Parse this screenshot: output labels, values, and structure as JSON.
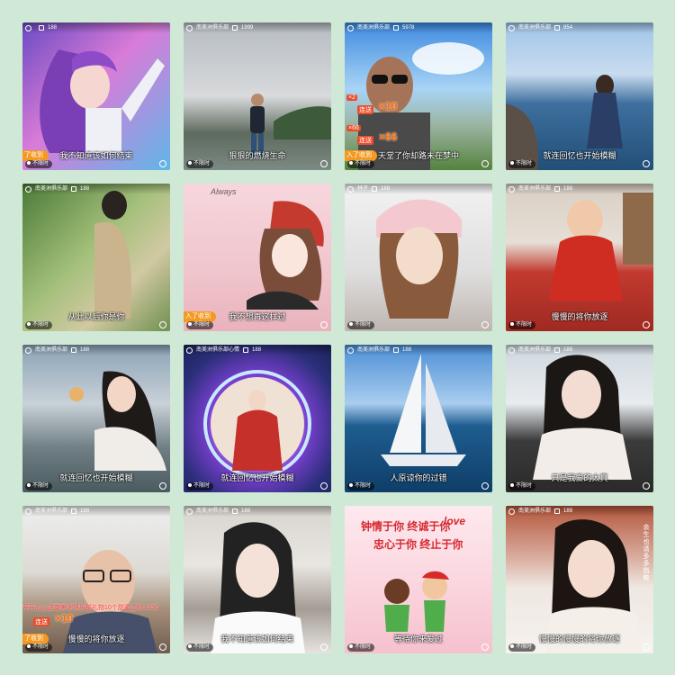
{
  "tiles": [
    {
      "header_name": "",
      "header_count": "188",
      "ticker": "了收到",
      "caption": "我不知道该如何结束",
      "tag": "不限时",
      "bg": "linear-gradient(135deg,#6b4bc2 0%,#d97bd8 45%,#5fb7e8 100%)"
    },
    {
      "header_name": "南美洲俱乐部",
      "header_count": "1999",
      "ticker": "",
      "caption": "狠狠的燃烧生命",
      "tag": "不限时",
      "bg": "linear-gradient(180deg,#b6bcc2 0%,#d8dadc 50%,#5d6a5e 75%,#7b8a84 100%)"
    },
    {
      "header_name": "南美洲俱乐部",
      "header_count": "5978",
      "ticker": "入了收到",
      "caption": "天堂了你却路未在梦中",
      "tag": "不限时",
      "bg": "linear-gradient(180deg,#3f8ae0 0%,#a8d4f5 45%,#9ab4a0 70%,#56823f 100%)",
      "combos": [
        {
          "label": "连送",
          "value": "×10"
        },
        {
          "label": "连送",
          "value": "×66"
        }
      ],
      "gift_counts": [
        "×2",
        "×66"
      ]
    },
    {
      "header_name": "南美洲俱乐部",
      "header_count": "954",
      "ticker": "",
      "caption": "就连回忆也开始模糊",
      "tag": "不限时",
      "bg": "linear-gradient(180deg,#9fc4e8 0%,#c9dcef 35%,#3e6f9e 55%,#224f78 100%)"
    },
    {
      "header_name": "南美洲俱乐部",
      "header_count": "188",
      "ticker": "",
      "caption": "从此以后你是你",
      "tag": "不限时",
      "bg": "linear-gradient(135deg,#4b7a38 0%,#a3c07a 45%,#d1c9a2 70%,#6f8f4f 100%)"
    },
    {
      "header_name": "",
      "header_count": "",
      "ticker": "入了收到",
      "caption": "我不想再这样过",
      "tag": "不限时",
      "bg": "linear-gradient(180deg,#f6d7dd 0%,#f0c5cc 60%,#e9b2bd 100%)",
      "handwritten": "Always"
    },
    {
      "header_name": "林子",
      "header_count": "188",
      "ticker": "",
      "caption": "",
      "tag": "不限时",
      "bg": "linear-gradient(180deg,#f2f2f2 0%,#dedede 60%,#bfb5b0 100%)"
    },
    {
      "header_name": "南美洲俱乐部",
      "header_count": "188",
      "ticker": "",
      "caption": "慢慢的将你放逐",
      "tag": "不限时",
      "bg": "linear-gradient(180deg,#d9cfc4 0%,#e6dfd6 40%,#c23a2f 60%,#9f2a22 100%)"
    },
    {
      "header_name": "南美洲俱乐部",
      "header_count": "188",
      "ticker": "",
      "caption": "就连回忆也开始模糊",
      "tag": "不限时",
      "bg": "linear-gradient(180deg,#8aa2b6 0%,#c9d1d8 40%,#6f7f84 70%,#4a5b60 100%)"
    },
    {
      "header_name": "南美洲俱乐部心情",
      "header_count": "188",
      "ticker": "",
      "caption": "就连回忆也开始模糊",
      "tag": "不限时",
      "bg": "radial-gradient(circle at 50% 55%,#ffffff 0%,#f3e5ff 25%,#7a3fd0 45%,#2b2f7a 75%,#1b2159 100%)"
    },
    {
      "header_name": "南美洲俱乐部",
      "header_count": "188",
      "ticker": "",
      "caption": "人原谅你的过错",
      "tag": "不限时",
      "bg": "linear-gradient(180deg,#4c8fd6 0%,#a9cdef 40%,#1e5d90 55%,#0f3e68 100%)"
    },
    {
      "header_name": "南美洲俱乐部",
      "header_count": "188",
      "ticker": "",
      "caption": "只是我爱的太真",
      "tag": "不限时",
      "bg": "linear-gradient(180deg,#cfd8df 0%,#e8ecef 40%,#3b3b3b 65%,#2a2a2a 100%)"
    },
    {
      "header_name": "南美洲俱乐部",
      "header_count": "188",
      "ticker": "了收到",
      "caption": "慢慢的将你放逐",
      "tag": "不限时",
      "bg": "linear-gradient(180deg,#eeeeee 0%,#dddad4 45%,#a78f7a 70%,#6d5b4e 100%)",
      "banner": "开开心心送南美洲俱乐部礼物10个甜蜜之吻 x150",
      "combos": [
        {
          "label": "连送",
          "value": "×10"
        }
      ]
    },
    {
      "header_name": "南美洲俱乐部",
      "header_count": "188",
      "ticker": "",
      "caption": "我不知道该如何结束",
      "tag": "不限时",
      "bg": "linear-gradient(180deg,#d8d4ce 0%,#e9e6e1 40%,#a59d95 70%,#e6e4e0 100%)"
    },
    {
      "header_name": "",
      "header_count": "",
      "ticker": "",
      "caption": "等待你来爱过",
      "tag": "不限时",
      "bg": "linear-gradient(180deg,#fde9ee 0%,#fbd7e0 50%,#f6c1cf 100%)",
      "poem_line1": "钟情于你 终诚于你",
      "poem_line2": "忠心于你 终止于你",
      "love_word": "love"
    },
    {
      "header_name": "南美洲俱乐部",
      "header_count": "188",
      "ticker": "",
      "caption": "慢慢的慢慢的将你放逐",
      "tag": "不限时",
      "bg": "linear-gradient(180deg,#b4563c 0%,#d9ad9f 35%,#efe7e1 55%,#f6f2ee 100%)",
      "side_text": "余生也请多多指教"
    }
  ]
}
